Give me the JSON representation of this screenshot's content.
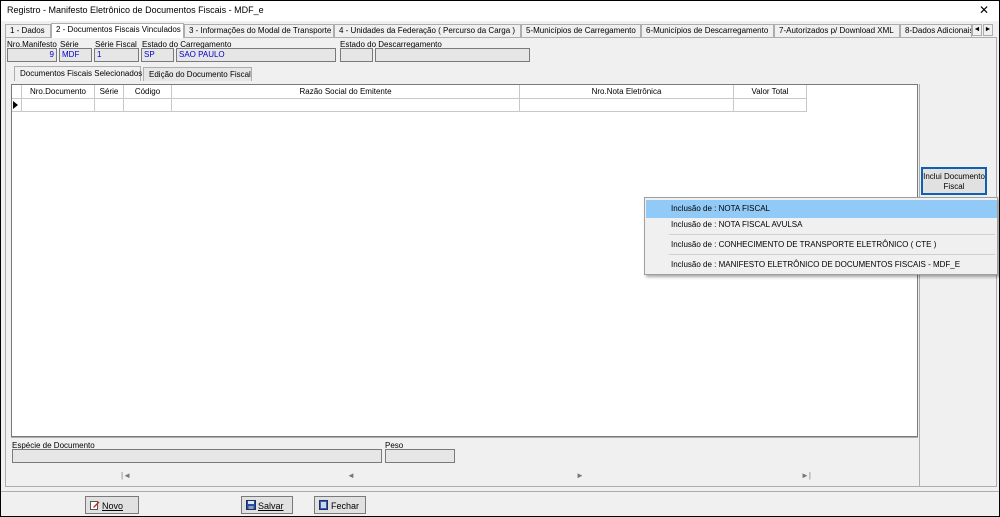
{
  "window": {
    "title": "Registro - Manifesto Eletrônico de Documentos Fiscais - MDF_e",
    "close_glyph": "✕"
  },
  "tabs": [
    {
      "label": "1 - Dados"
    },
    {
      "label": "2 - Documentos Fiscais Vinculados",
      "active": true
    },
    {
      "label": "3 - Informações do Modal de Transporte"
    },
    {
      "label": "4 - Unidades da Federação ( Percurso da Carga )"
    },
    {
      "label": "5-Municípios de Carregamento"
    },
    {
      "label": "6-Municípios de Descarregamento"
    },
    {
      "label": "7-Autorizados p/ Download XML"
    },
    {
      "label": "8-Dados Adicionais"
    }
  ],
  "tab_scroll": {
    "left": "◄",
    "right": "►"
  },
  "header": {
    "nro_manifesto_label": "Nro.Manifesto",
    "nro_manifesto_value": "9",
    "serie_label": "Série",
    "serie_value": "MDF",
    "serie_fiscal_label": "Série Fiscal",
    "serie_fiscal_value": "1",
    "estado_carregamento_label": "Estado do Carregamento",
    "estado_carregamento_uf": "SP",
    "estado_carregamento_nome": "SAO PAULO",
    "estado_descarregamento_label": "Estado do Descarregamento",
    "estado_descarregamento_uf": "",
    "estado_descarregamento_nome": ""
  },
  "subtabs": [
    {
      "label": "Documentos Fiscais Selecionados",
      "active": true
    },
    {
      "label": "Edição do Documento Fiscal"
    }
  ],
  "grid": {
    "columns": [
      "Nro.Documento",
      "Série",
      "Código",
      "Razão Social do Emitente",
      "Nro.Nota Eletrônica",
      "Valor Total"
    ]
  },
  "bottom": {
    "especie_label": "Espécie de Documento",
    "especie_value": "",
    "peso_label": "Peso",
    "peso_value": ""
  },
  "navigator": {
    "first": "|◄",
    "prev": "◄",
    "next": "►",
    "last": "►|"
  },
  "side": {
    "inclui_label_line1": "Inclui Documento",
    "inclui_label_line2": "Fiscal"
  },
  "context_menu": [
    {
      "label": "Inclusão de : NOTA FISCAL",
      "highlighted": true
    },
    {
      "label": "Inclusão de : NOTA FISCAL AVULSA"
    },
    {
      "label": "Inclusão de : CONHECIMENTO DE TRANSPORTE ELETRÔNICO ( CTE )"
    },
    {
      "label": "Inclusão de : MANIFESTO ELETRÔNICO DE DOCUMENTOS FISCAIS - MDF_E"
    }
  ],
  "footer": {
    "novo_label": "Novo",
    "salvar_label": "Salvar",
    "fechar_label": "Fechar"
  },
  "colors": {
    "value_text": "#0000cc",
    "menu_highlight": "#91c9f7",
    "button_focus_border": "#0f5fb3"
  }
}
